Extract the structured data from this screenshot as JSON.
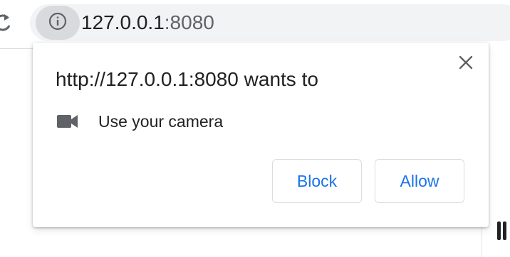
{
  "browser": {
    "address": {
      "host": "127.0.0.1",
      "port": ":8080"
    },
    "icons": {
      "reload": "reload-icon",
      "site_info": "info-icon"
    }
  },
  "permission_prompt": {
    "title": "http://127.0.0.1:8080 wants to",
    "permission": {
      "icon": "camera-icon",
      "label": "Use your camera"
    },
    "buttons": {
      "block": "Block",
      "allow": "Allow"
    },
    "close_icon": "close-icon"
  },
  "colors": {
    "accent": "#1a73e8",
    "text": "#202124",
    "muted": "#5f6368",
    "omnibox_bg": "#f1f3f4",
    "chip_bg": "#d8dadd",
    "border": "#dadce0"
  }
}
